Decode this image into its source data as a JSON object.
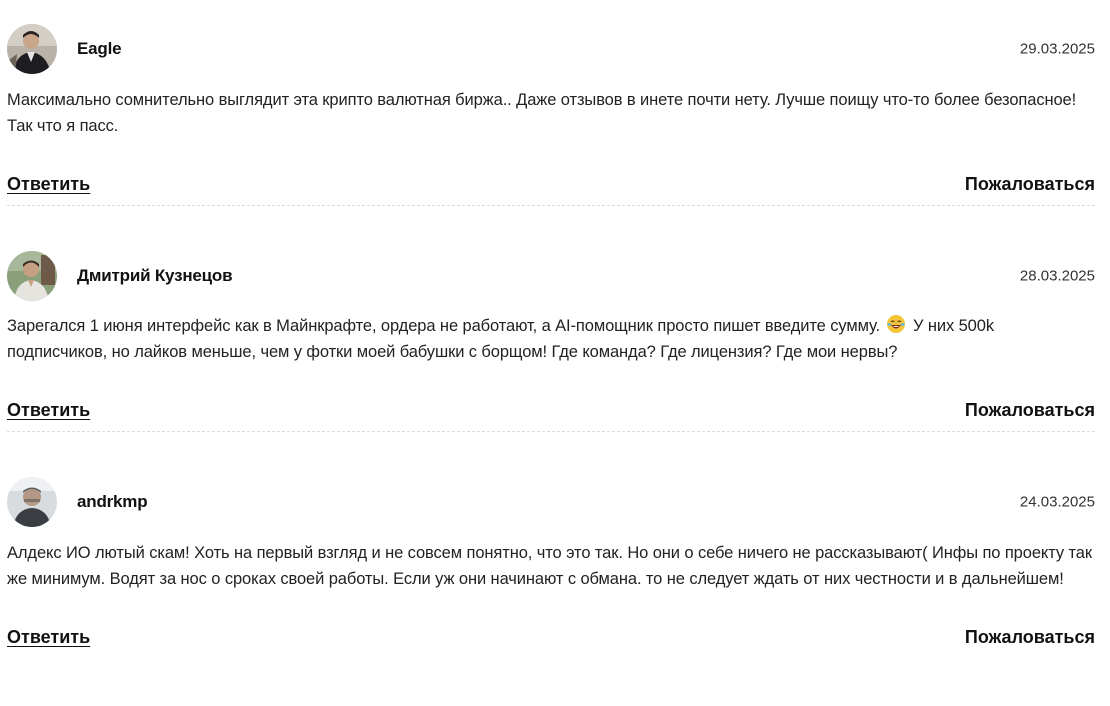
{
  "comments": [
    {
      "author": "Eagle",
      "date": "29.03.2025",
      "avatar": "avatar-photo-man-dark-jacket",
      "text": "Максимально сомнительно выглядит эта крипто валютная биржа.. Даже отзывов в инете почти нету. Лучше поищу что-то более безопасное! Так что я пасс.",
      "reply_label": "Ответить",
      "report_label": "Пожаловаться"
    },
    {
      "author": "Дмитрий Кузнецов",
      "date": "28.03.2025",
      "avatar": "avatar-photo-man-outdoors",
      "text_before_emoji": "Зарегался 1 июня интерфейс как в Майнкрафте, ордера не работают, а AI-помощник просто пишет введите сумму.",
      "emoji": "laughing-tears-emoji",
      "text_after_emoji": "У них 500k подписчиков, но лайков меньше, чем у фотки моей бабушки с борщом! Где команда? Где лицензия? Где мои нервы?",
      "reply_label": "Ответить",
      "report_label": "Пожаловаться"
    },
    {
      "author": "andrkmp",
      "date": "24.03.2025",
      "avatar": "avatar-photo-man-light-background",
      "text": "Алдекс ИО лютый скам! Хоть на первый взгляд и не совсем понятно, что это так. Но они о себе ничего не рассказывают( Инфы по проекту так же минимум. Водят за нос о сроках своей работы. Если уж они начинают с обмана. то не следует ждать от них честности и в дальнейшем!",
      "reply_label": "Ответить",
      "report_label": "Пожаловаться"
    }
  ]
}
